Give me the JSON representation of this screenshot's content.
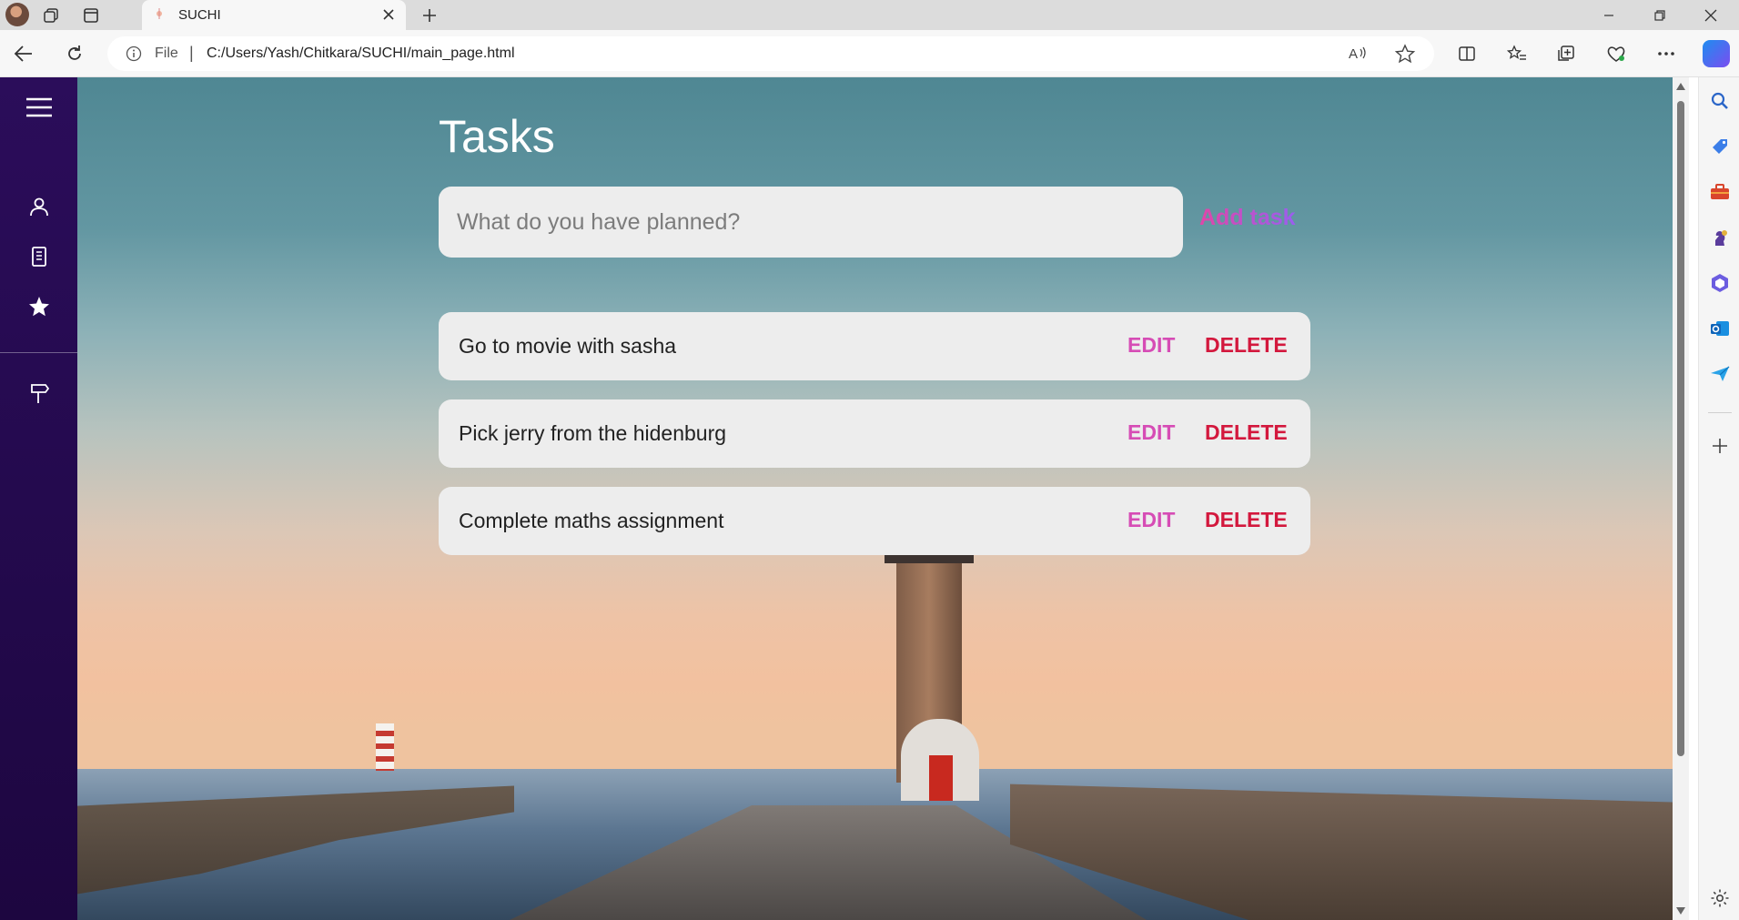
{
  "browser": {
    "tab_title": "SUCHI",
    "address_scheme": "File",
    "address_separator": "|",
    "url": "C:/Users/Yash/Chitkara/SUCHI/main_page.html"
  },
  "app": {
    "title": "Tasks",
    "input_placeholder": "What do you have planned?",
    "add_label": "Add task",
    "tasks": [
      {
        "text": "Go to movie with sasha",
        "edit": "EDIT",
        "delete": "DELETE"
      },
      {
        "text": "Pick jerry from the hidenburg",
        "edit": "EDIT",
        "delete": "DELETE"
      },
      {
        "text": "Complete maths assignment",
        "edit": "EDIT",
        "delete": "DELETE"
      }
    ]
  },
  "colors": {
    "sidebar": "#2b0d5a",
    "edit": "#d64cb5",
    "delete": "#d3183d",
    "add_gradient_start": "#e145a8",
    "add_gradient_end": "#9a5ef0"
  },
  "icons": {
    "app_sidebar": [
      "menu-icon",
      "user-icon",
      "building-icon",
      "star-icon",
      "signpost-icon"
    ],
    "edge_sidebar": [
      "search-icon",
      "shopping-tag-icon",
      "toolbox-icon",
      "chess-icon",
      "office-icon",
      "outlook-icon",
      "send-icon",
      "plus-icon",
      "settings-icon"
    ]
  }
}
